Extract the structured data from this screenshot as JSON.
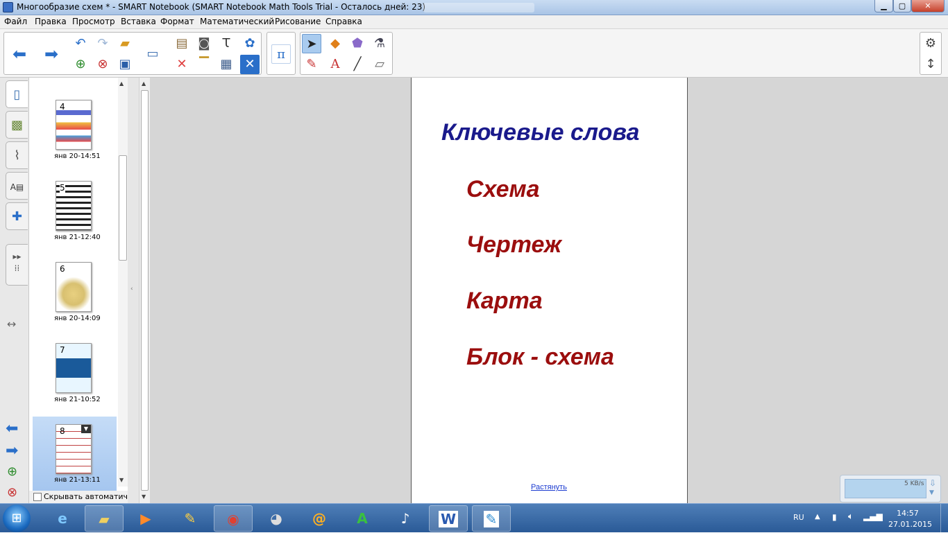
{
  "window": {
    "title": "Многообразие схем * - SMART Notebook (SMART Notebook Math Tools Trial - Осталось дней: 23)"
  },
  "menu": [
    "Файл",
    "Правка",
    "Просмотр",
    "Вставка",
    "Формат",
    "Математический",
    "Рисование",
    "Справка"
  ],
  "toolbar": {
    "pi_label": "π"
  },
  "sorter": {
    "pages": [
      {
        "num": "4",
        "date": "янв 20-14:51"
      },
      {
        "num": "5",
        "date": "янв 21-12:40"
      },
      {
        "num": "6",
        "date": "янв 20-14:09"
      },
      {
        "num": "7",
        "date": "янв 21-10:52"
      },
      {
        "num": "8",
        "date": "янв 21-13:11"
      }
    ],
    "autohide_label": "Скрывать автоматическ"
  },
  "page": {
    "heading": "Ключевые слова",
    "items": [
      "Схема",
      "Чертеж",
      "Карта",
      "Блок - схема"
    ],
    "stretch_link": "Растянуть",
    "heading_color": "#1a1a8c",
    "item_color": "#9b0e0e"
  },
  "netwidget": {
    "speed": "5 KB/s"
  },
  "tray": {
    "lang": "RU",
    "time": "14:57",
    "date": "27.01.2015"
  }
}
